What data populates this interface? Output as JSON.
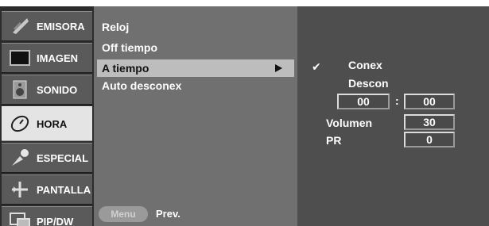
{
  "sidebar": {
    "items": [
      {
        "label": "EMISORA",
        "icon": "satellite-dish-icon"
      },
      {
        "label": "IMAGEN",
        "icon": "monitor-icon"
      },
      {
        "label": "SONIDO",
        "icon": "speaker-icon"
      },
      {
        "label": "HORA",
        "icon": "clock-icon"
      },
      {
        "label": "ESPECIAL",
        "icon": "special-icon"
      },
      {
        "label": "PANTALLA",
        "icon": "screen-adjust-icon"
      },
      {
        "label": "PIP/DW",
        "icon": "pip-icon"
      }
    ],
    "active_index": 3
  },
  "submenu": {
    "items": [
      "Reloj",
      "Off tiempo",
      "A tiempo",
      "Auto desconex"
    ],
    "selected": "A tiempo",
    "menu_button": "Menu",
    "prev_label": "Prev."
  },
  "detail": {
    "option_on": "Conex",
    "option_off": "Descon",
    "hour": "00",
    "separator": ":",
    "minute": "00",
    "volume_label": "Volumen",
    "volume_value": "30",
    "pr_label": "PR",
    "pr_value": "0",
    "check_mark": "✔"
  },
  "colors": {
    "sidebar_bg": "#2c2c2c",
    "item_bg": "#5a5a5a",
    "active_item_bg": "#e4e4e4",
    "submenu_bg": "#707070",
    "highlight_bg": "#bdbdbd",
    "detail_bg": "#4e4e4e"
  }
}
